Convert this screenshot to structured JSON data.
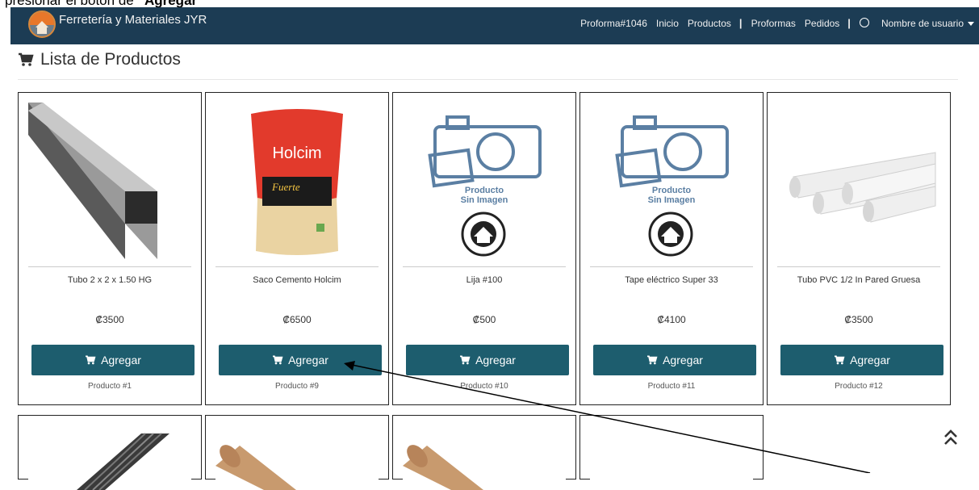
{
  "doc_text": {
    "prefix": "presionar el botón de ",
    "bold": "“Agregar”"
  },
  "navbar": {
    "brand": "Ferretería y Materiales JYR",
    "links": [
      "Proforma#1046",
      "Inicio",
      "Productos",
      "Proformas",
      "Pedidos"
    ],
    "separator": "|",
    "user": "Nombre de usuario"
  },
  "page": {
    "title": "Lista de Productos"
  },
  "products": [
    {
      "name": "Tubo 2 x 2 x 1.50 HG",
      "price": "₡3500",
      "button": "Agregar",
      "code": "Producto #1",
      "image": "square-steel-tube"
    },
    {
      "name": "Saco Cemento Holcim",
      "price": "₡6500",
      "button": "Agregar",
      "code": "Producto #9",
      "image": "cement-bag",
      "image_text": {
        "brand": "Holcim",
        "variant": "Fuerte"
      }
    },
    {
      "name": "Lija #100",
      "price": "₡500",
      "button": "Agregar",
      "code": "Producto #10",
      "image": "no-image-placeholder",
      "image_text": {
        "line1": "Producto",
        "line2": "Sin Imagen"
      }
    },
    {
      "name": "Tape eléctrico Super 33",
      "price": "₡4100",
      "button": "Agregar",
      "code": "Producto #11",
      "image": "no-image-placeholder",
      "image_text": {
        "line1": "Producto",
        "line2": "Sin Imagen"
      }
    },
    {
      "name": "Tubo PVC 1/2 In Pared Gruesa",
      "price": "₡3500",
      "button": "Agregar",
      "code": "Producto #12",
      "image": "pvc-pipes"
    }
  ],
  "row2_images": [
    "black-rods",
    "cardboard-tube",
    "cardboard-tube",
    "blank"
  ],
  "colors": {
    "navbar": "#1c3c54",
    "button": "#1d5d6e"
  },
  "icons": {
    "cart": "cart-icon",
    "user": "user-circle-icon",
    "scroll_top": "double-chevron-up-icon"
  }
}
